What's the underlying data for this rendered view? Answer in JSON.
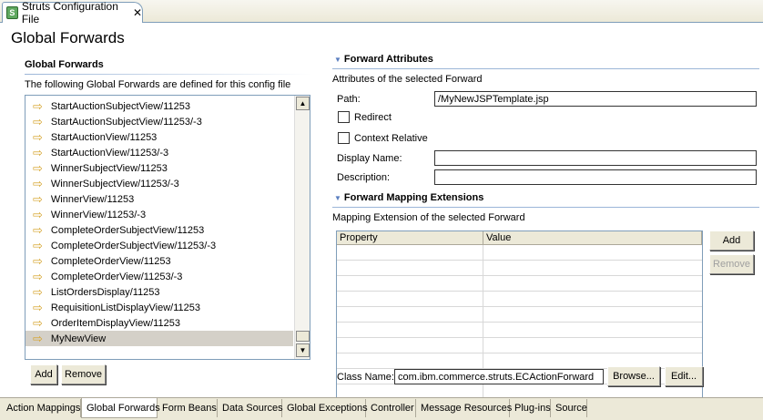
{
  "editor": {
    "tab_title": "Struts Configuration File",
    "tab_icon": "struts-config-file-icon",
    "close_glyph": "✕"
  },
  "page": {
    "title": "Global Forwards"
  },
  "left": {
    "section_title": "Global Forwards",
    "description": "The following Global Forwards are defined for this config file",
    "items": [
      "StartAuctionSubjectView/11253",
      "StartAuctionSubjectView/11253/-3",
      "StartAuctionView/11253",
      "StartAuctionView/11253/-3",
      "WinnerSubjectView/11253",
      "WinnerSubjectView/11253/-3",
      "WinnerView/11253",
      "WinnerView/11253/-3",
      "CompleteOrderSubjectView/11253",
      "CompleteOrderSubjectView/11253/-3",
      "CompleteOrderView/11253",
      "CompleteOrderView/11253/-3",
      "ListOrdersDisplay/11253",
      "RequisitionListDisplayView/11253",
      "OrderItemDisplayView/11253",
      "MyNewView"
    ],
    "selected_item": "MyNewView",
    "add_label": "Add",
    "remove_label": "Remove"
  },
  "attributes": {
    "section_title": "Forward Attributes",
    "description": "Attributes of the selected Forward",
    "path_label": "Path:",
    "path_value": "/MyNewJSPTemplate.jsp",
    "redirect_label": "Redirect",
    "redirect_checked": false,
    "context_relative_label": "Context Relative",
    "context_relative_checked": false,
    "display_name_label": "Display Name:",
    "display_name_value": "",
    "description_label": "Description:",
    "description_value": ""
  },
  "extensions": {
    "section_title": "Forward Mapping Extensions",
    "description": "Mapping Extension of the selected Forward",
    "columns": [
      "Property",
      "Value"
    ],
    "rows": [],
    "add_label": "Add",
    "remove_label": "Remove",
    "class_name_label": "Class Name:",
    "class_name_value": "com.ibm.commerce.struts.ECActionForward",
    "browse_label": "Browse...",
    "edit_label": "Edit..."
  },
  "bottom_tabs": [
    "Action Mappings",
    "Global Forwards",
    "Form Beans",
    "Data Sources",
    "Global Exceptions",
    "Controller",
    "Message Resources",
    "Plug-ins",
    "Source"
  ],
  "active_bottom_tab": "Global Forwards",
  "colors": {
    "section_line": "#9cb6d8",
    "selection": "#d4d0c8",
    "forward_icon": "#d6a52e",
    "chrome": "#ece9d8"
  }
}
